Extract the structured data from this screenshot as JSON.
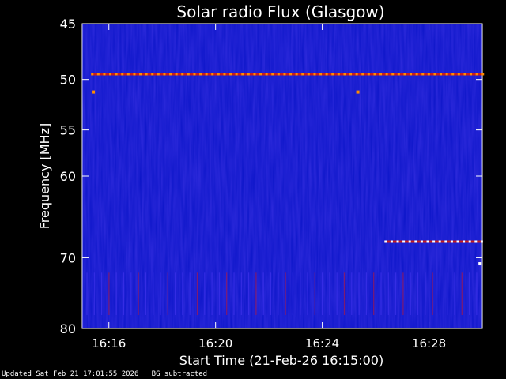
{
  "chart_data": {
    "type": "heatmap",
    "title": "Solar radio Flux (Glasgow)",
    "xlabel": "Start Time (21-Feb-26 16:15:00)",
    "ylabel": "Frequency [MHz]",
    "x_range_minutes": [
      "16:15",
      "16:30"
    ],
    "x_ticks": [
      "16:16",
      "16:20",
      "16:24",
      "16:28"
    ],
    "y_scale": "log",
    "ylim": [
      45,
      80
    ],
    "y_ticks": [
      45,
      50,
      55,
      60,
      70,
      80
    ],
    "y_ticks_labeled": [
      45,
      50,
      55,
      60,
      70,
      80
    ],
    "colormap": [
      "#0000c8",
      "#2a1fe0",
      "#c81e1e",
      "#ff8c00",
      "#ffffff"
    ],
    "features": [
      {
        "kind": "persistent-line",
        "frequency": 49.5,
        "x_start": "16:15:20",
        "x_end": "16:30:00",
        "intensity": "high"
      },
      {
        "kind": "persistent-line",
        "frequency": 67.9,
        "x_start": "16:26:20",
        "x_end": "16:30:00",
        "intensity": "very-high"
      },
      {
        "kind": "spot",
        "frequency": 51.2,
        "x": "16:15:25",
        "intensity": "high"
      },
      {
        "kind": "spot",
        "frequency": 51.2,
        "x": "16:25:20",
        "intensity": "high"
      },
      {
        "kind": "spot",
        "frequency": 70.8,
        "x": "16:29:55",
        "intensity": "very-high"
      },
      {
        "kind": "vertical-streaks",
        "frequency_range": [
          72,
          78
        ],
        "x_start": "16:15:00",
        "x_end": "16:30:00",
        "intensity": "low"
      }
    ]
  },
  "footer": {
    "updated": "Updated Sat Feb 21 17:01:55 2026",
    "note": "BG subtracted"
  }
}
